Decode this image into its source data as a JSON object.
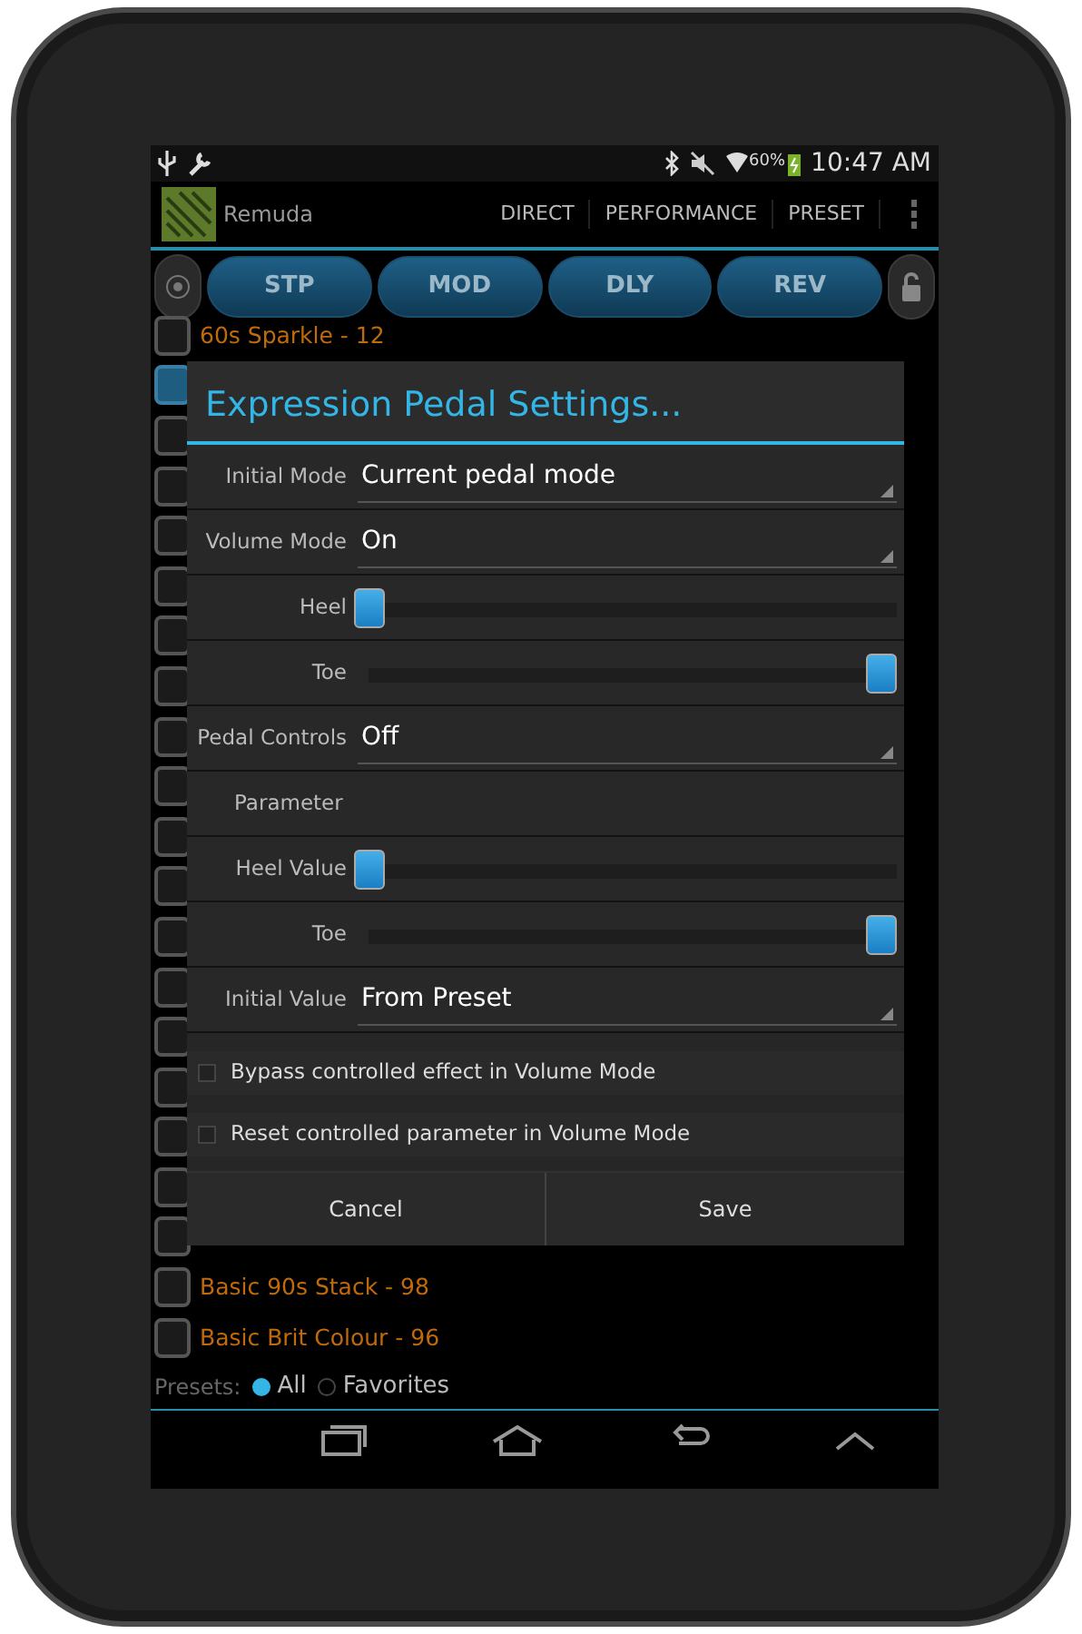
{
  "status_bar": {
    "battery": "60%",
    "time": "10:47 AM"
  },
  "action_bar": {
    "title": "Remuda",
    "actions": [
      "DIRECT",
      "PERFORMANCE",
      "PRESET"
    ]
  },
  "effect_buttons": [
    "STP",
    "MOD",
    "DLY",
    "REV"
  ],
  "presets": [
    {
      "name": "60s Sparkle - 12",
      "checked": false
    },
    {
      "checked": true
    },
    {
      "checked": false
    },
    {
      "checked": false
    },
    {
      "checked": false
    },
    {
      "checked": false
    },
    {
      "checked": false
    },
    {
      "checked": false
    },
    {
      "checked": false
    },
    {
      "checked": false
    },
    {
      "checked": false
    },
    {
      "checked": false
    },
    {
      "checked": false
    },
    {
      "checked": false
    },
    {
      "checked": false
    },
    {
      "checked": false
    },
    {
      "checked": false
    },
    {
      "checked": false
    },
    {
      "checked": false
    },
    {
      "name": "Basic 90s Stack - 98",
      "checked": false
    },
    {
      "name": "Basic Brit Colour - 96",
      "checked": false
    }
  ],
  "dialog": {
    "title": "Expression Pedal Settings...",
    "rows": [
      {
        "kind": "select",
        "label": "Initial Mode",
        "value": "Current pedal mode"
      },
      {
        "kind": "select",
        "label": "Volume Mode",
        "value": "On"
      },
      {
        "kind": "slider",
        "label": "Heel",
        "level": 0
      },
      {
        "kind": "slider",
        "label": "Toe",
        "level": 1
      },
      {
        "kind": "select",
        "label": "Pedal Controls",
        "value": "Off"
      },
      {
        "kind": "header",
        "label": "Parameter"
      },
      {
        "kind": "slider",
        "label": "Heel Value",
        "level": 0
      },
      {
        "kind": "slider",
        "label": "Toe",
        "level": 1
      },
      {
        "kind": "select",
        "label": "Initial Value",
        "value": "From Preset"
      },
      {
        "kind": "checkbox",
        "label": "Bypass controlled effect in Volume Mode",
        "checked": false
      },
      {
        "kind": "checkbox",
        "label": "Reset controlled parameter in Volume Mode",
        "checked": false
      }
    ],
    "buttons": [
      "Cancel",
      "Save"
    ]
  },
  "filter": {
    "label": "Presets:",
    "options": [
      {
        "label": "All",
        "selected": true
      },
      {
        "label": "Favorites",
        "selected": false
      }
    ]
  }
}
